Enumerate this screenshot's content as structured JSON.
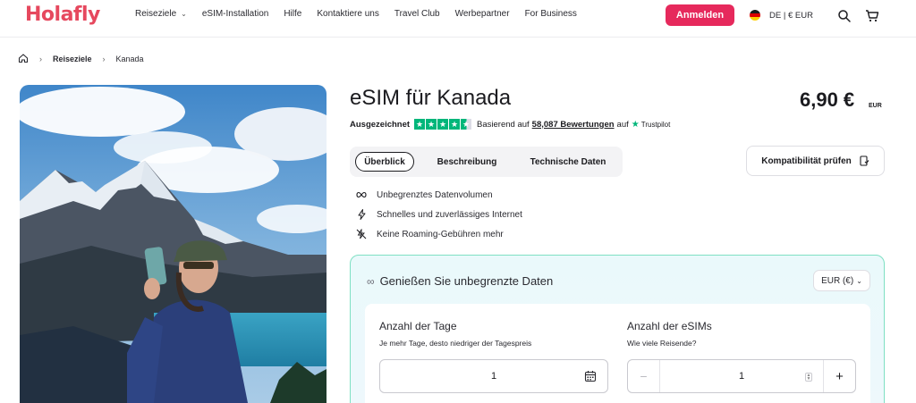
{
  "header": {
    "logo": "Holafly",
    "nav": [
      {
        "label": "Reiseziele",
        "dropdown": true
      },
      {
        "label": "eSIM-Installation"
      },
      {
        "label": "Hilfe"
      },
      {
        "label": "Kontaktiere uns"
      },
      {
        "label": "Travel Club"
      },
      {
        "label": "Werbepartner"
      },
      {
        "label": "For Business"
      }
    ],
    "login_label": "Anmelden",
    "language_label": "DE | € EUR",
    "icons": [
      "search-icon",
      "cart-icon"
    ]
  },
  "breadcrumb": {
    "home_icon": "home-icon",
    "items": [
      "Reiseziele",
      "Kanada"
    ]
  },
  "product": {
    "title": "eSIM für Kanada",
    "price": "6,90 €",
    "currency": "EUR",
    "rating_label": "Ausgezeichnet",
    "stars": 4.5,
    "review_prefix": "Basierend auf",
    "review_link": "58,087 Bewertungen",
    "review_suffix": "auf",
    "trustpilot": "Trustpilot"
  },
  "tabs": [
    "Überblick",
    "Beschreibung",
    "Technische Daten"
  ],
  "compat_button": "Kompatibilität prüfen",
  "features": [
    {
      "icon": "infinity-icon",
      "label": "Unbegrenztes Datenvolumen"
    },
    {
      "icon": "bolt-icon",
      "label": "Schnelles und zuverlässiges Internet"
    },
    {
      "icon": "no-roaming-icon",
      "label": "Keine Roaming-Gebühren mehr"
    }
  ],
  "plan": {
    "title": "Genießen Sie unbegrenzte Daten",
    "currency_select": "EUR (€)",
    "days_title": "Anzahl der Tage",
    "days_sub": "Je mehr Tage, desto niedriger der Tagespreis",
    "days_value": "1",
    "esims_title": "Anzahl der eSIMs",
    "esims_sub": "Wie viele Reisende?",
    "esims_value": "1",
    "minus": "−",
    "plus": "+"
  },
  "colors": {
    "brand": "#e6485e",
    "button": "#e6295c",
    "trustpilot": "#00b67a",
    "plan_border": "#7ee0c3"
  }
}
